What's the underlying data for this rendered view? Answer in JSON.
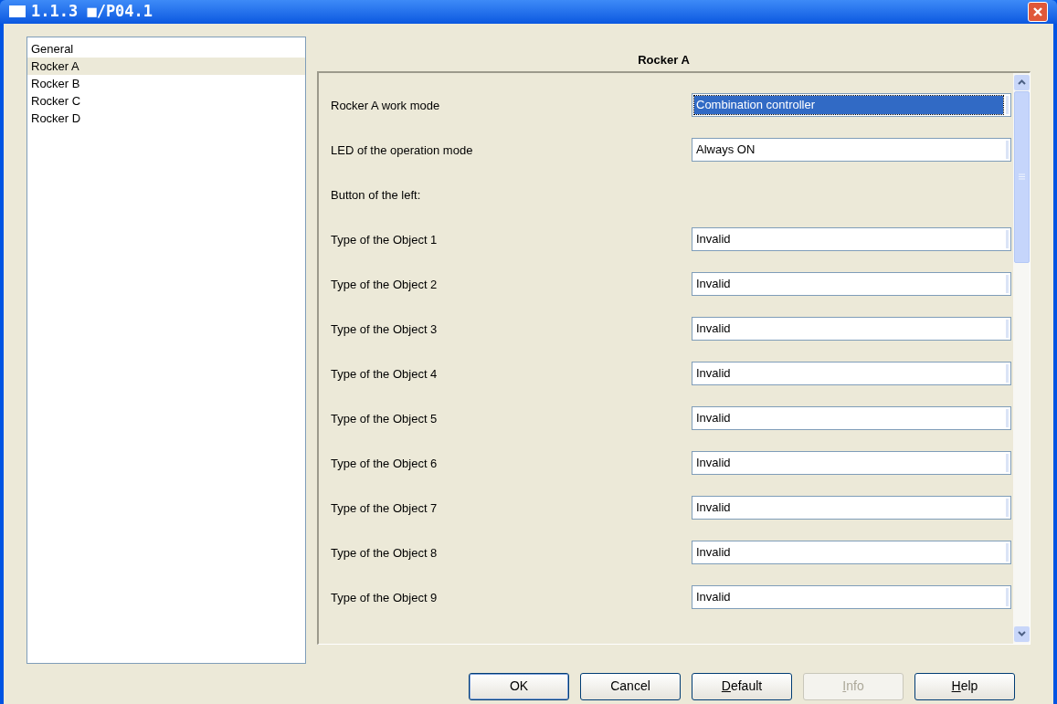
{
  "window": {
    "title": "1.1.3 ■/P04.1"
  },
  "sidebar": {
    "items": [
      {
        "label": "General",
        "selected": false
      },
      {
        "label": "Rocker A",
        "selected": true
      },
      {
        "label": "Rocker B",
        "selected": false
      },
      {
        "label": "Rocker C",
        "selected": false
      },
      {
        "label": "Rocker D",
        "selected": false
      }
    ]
  },
  "panel": {
    "title": "Rocker A",
    "rows": [
      {
        "kind": "select",
        "label": "Rocker A work mode",
        "value": "Combination controller",
        "selected": true
      },
      {
        "kind": "select",
        "label": "LED of the operation mode",
        "value": "Always ON",
        "selected": false
      },
      {
        "kind": "heading",
        "label": "Button of the left:"
      },
      {
        "kind": "select",
        "label": "Type of the Object 1",
        "value": "Invalid",
        "selected": false
      },
      {
        "kind": "select",
        "label": "Type of the Object 2",
        "value": "Invalid",
        "selected": false
      },
      {
        "kind": "select",
        "label": "Type of the Object 3",
        "value": "Invalid",
        "selected": false
      },
      {
        "kind": "select",
        "label": "Type of the Object 4",
        "value": "Invalid",
        "selected": false
      },
      {
        "kind": "select",
        "label": "Type of the Object 5",
        "value": "Invalid",
        "selected": false
      },
      {
        "kind": "select",
        "label": "Type of the Object 6",
        "value": "Invalid",
        "selected": false
      },
      {
        "kind": "select",
        "label": "Type of the Object 7",
        "value": "Invalid",
        "selected": false
      },
      {
        "kind": "select",
        "label": "Type of the Object 8",
        "value": "Invalid",
        "selected": false
      },
      {
        "kind": "select",
        "label": "Type of the Object 9",
        "value": "Invalid",
        "selected": false
      }
    ]
  },
  "buttons": [
    {
      "label": "OK",
      "default": true,
      "disabled": false,
      "underline_first": false
    },
    {
      "label": "Cancel",
      "default": false,
      "disabled": false,
      "underline_first": false
    },
    {
      "label": "Default",
      "default": false,
      "disabled": false,
      "underline_first": true
    },
    {
      "label": "Info",
      "default": false,
      "disabled": true,
      "underline_first": true
    },
    {
      "label": "Help",
      "default": false,
      "disabled": false,
      "underline_first": true
    }
  ]
}
